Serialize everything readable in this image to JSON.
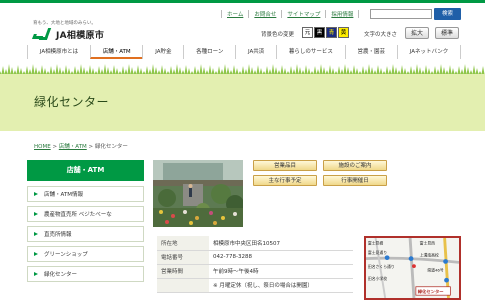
{
  "header": {
    "tagline": "育もう、大地と地域のみらい。",
    "logo_text": "JA相模原市",
    "top_links": [
      "ホーム",
      "お問合せ",
      "サイトマップ",
      "採用情報"
    ],
    "search_button": "検索",
    "search_placeholder": "",
    "bg_color_label": "背景色の変更",
    "bg_color_options": [
      "元",
      "黒",
      "青",
      "黄"
    ],
    "font_size_label": "文字の大きさ",
    "font_size_large": "拡大",
    "font_size_standard": "標準"
  },
  "nav": {
    "items": [
      "JA相模原市とは",
      "店舗・ATM",
      "JA貯金",
      "各種ローン",
      "JA共済",
      "暮らしのサービス",
      "営農・園芸",
      "JAネットバンク"
    ],
    "active_index": 1
  },
  "hero": {
    "title": "緑化センター"
  },
  "breadcrumb": {
    "home": "HOME",
    "separator": ">",
    "parent": "店舗・ATM",
    "current": "緑化センター"
  },
  "sidebar": {
    "heading": "店舗・ATM",
    "items": [
      "店舗・ATM情報",
      "農産物直売所 ベジたべーな",
      "直売所情報",
      "グリーンショップ",
      "緑化センター"
    ]
  },
  "content_buttons": [
    "営業品目",
    "施設のご案内",
    "主な行事予定",
    "行事開催日"
  ],
  "info_table": [
    {
      "label": "所在地",
      "value": "相模原市中央区田名10507"
    },
    {
      "label": "電話番号",
      "value": "042-778-3288"
    },
    {
      "label": "営業時間",
      "value": "午前9時～午後4時"
    },
    {
      "label": "",
      "value": "※ 月曜定休（祝し、祭日の場合は開園）"
    }
  ],
  "map": {
    "labels": [
      "富士見橋",
      "富士見西",
      "富士見通り",
      "上溝南高校",
      "県道46号",
      "田名さくら通り",
      "田名小学校",
      "緑化センター"
    ]
  },
  "colors": {
    "brand_green": "#009944",
    "hero_bg": "#e3efb0",
    "active_tab_underline": "#e07020",
    "button_gold": "#f0d88a",
    "search_blue": "#1f5fa8"
  }
}
